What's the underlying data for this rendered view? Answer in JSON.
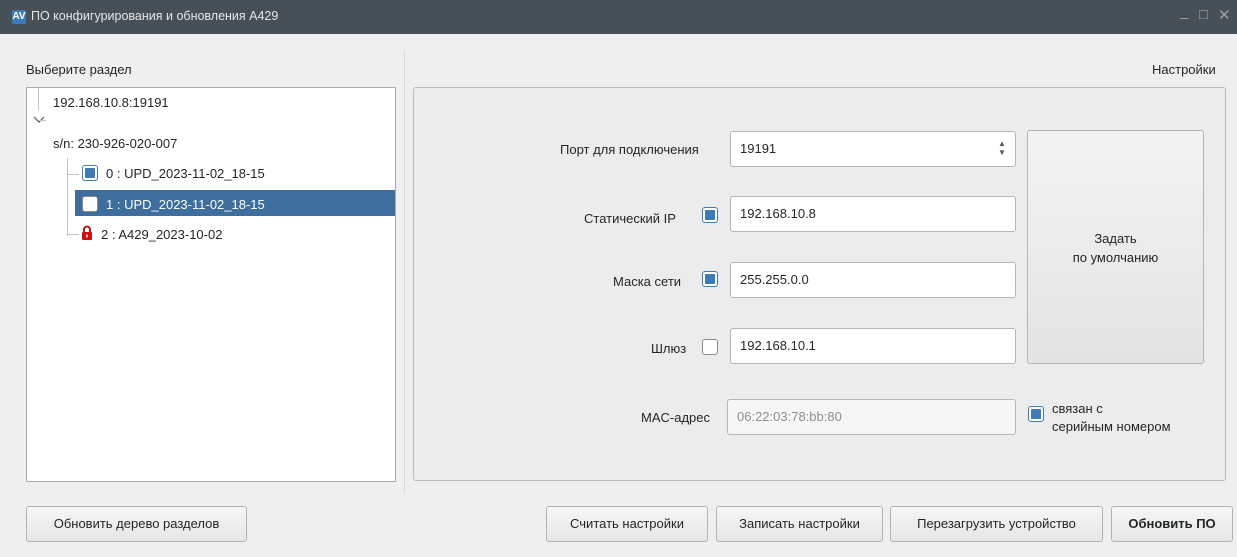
{
  "window": {
    "title": "ПО конфигурирования и обновления A429",
    "app_icon": "AV",
    "minimize": "_",
    "maximize": "□",
    "close": "✕"
  },
  "left": {
    "section_label": "Выберите раздел",
    "tree": {
      "host": "192.168.10.8:19191",
      "serial": "s/n: 230-926-020-007",
      "partitions": [
        {
          "label": "0 : UPD_2023-11-02_18-15",
          "state": "checked"
        },
        {
          "label": "1 : UPD_2023-11-02_18-15",
          "state": "selected"
        },
        {
          "label": "2 : A429_2023-10-02",
          "state": "locked"
        }
      ]
    },
    "refresh_button": "Обновить дерево разделов"
  },
  "right": {
    "settings_label": "Настройки",
    "port": {
      "label": "Порт для подключения",
      "value": "19191"
    },
    "static_ip": {
      "label": "Статический IP",
      "checked": true,
      "value": "192.168.10.8"
    },
    "netmask": {
      "label": "Маска сети",
      "checked": true,
      "value": "255.255.0.0"
    },
    "gateway": {
      "label": "Шлюз",
      "checked": false,
      "value": "192.168.10.1"
    },
    "mac": {
      "label": "MAC-адрес",
      "value": "06:22:03:78:bb:80",
      "link_line1": "связан с",
      "link_line2": "серийным номером",
      "link_checked": true
    },
    "default_button_line1": "Задать",
    "default_button_line2": "по умолчанию"
  },
  "bottom": {
    "read_settings": "Считать настройки",
    "write_settings": "Записать настройки",
    "reboot_device": "Перезагрузить устройство",
    "update_fw": "Обновить ПО"
  },
  "colors": {
    "titlebar": "#475057",
    "selection": "#3d6e9e",
    "check_fill": "#3f7ab2",
    "lock": "#d01010"
  }
}
